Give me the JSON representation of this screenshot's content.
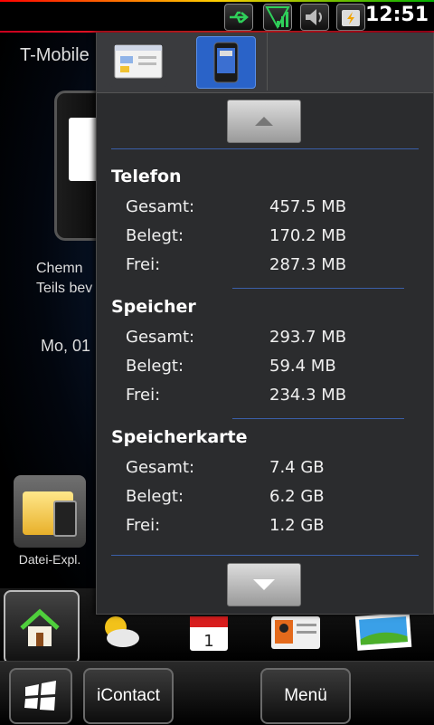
{
  "status_bar": {
    "time": "12:51",
    "icons": [
      "usb-icon",
      "signal-icon",
      "volume-icon",
      "battery-charging-icon"
    ]
  },
  "home": {
    "carrier": "T-Mobile",
    "city_line1": "Chemn",
    "city_line2": "Teils bev",
    "date_line": "Mo, 01",
    "file_app_label": "Datei-Expl."
  },
  "popup": {
    "tabs": [
      "file-explorer-tab",
      "device-info-tab"
    ],
    "sections": [
      {
        "title": "Telefon",
        "rows": [
          {
            "label": "Gesamt:",
            "value": "457.5 MB"
          },
          {
            "label": "Belegt:",
            "value": "170.2 MB"
          },
          {
            "label": "Frei:",
            "value": "287.3 MB"
          }
        ]
      },
      {
        "title": "Speicher",
        "rows": [
          {
            "label": "Gesamt:",
            "value": "293.7 MB"
          },
          {
            "label": "Belegt:",
            "value": "59.4 MB"
          },
          {
            "label": "Frei:",
            "value": "234.3 MB"
          }
        ]
      },
      {
        "title": "Speicherkarte",
        "rows": [
          {
            "label": "Gesamt:",
            "value": "7.4 GB"
          },
          {
            "label": "Belegt:",
            "value": "6.2 GB"
          },
          {
            "label": "Frei:",
            "value": "1.2 GB"
          }
        ]
      }
    ]
  },
  "calendar_day": "1",
  "bottom_bar": {
    "contact_label": "iContact",
    "menu_label": "Menü"
  },
  "colors": {
    "accent": "#2a63c8",
    "separator": "#3b5fa8",
    "popup_bg": "#2b2c2e"
  }
}
